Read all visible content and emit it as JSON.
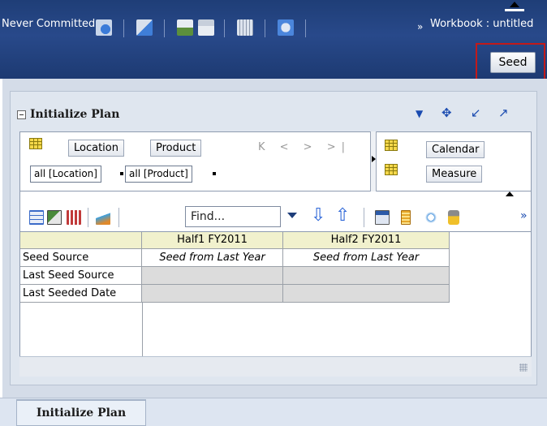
{
  "header": {
    "status_text": "Never Committed",
    "more_label": "»",
    "workbook_label": "Workbook : untitled",
    "seed_button": "Seed"
  },
  "panel": {
    "title": "Initialize Plan"
  },
  "dimensions": {
    "location_button": "Location",
    "product_button": "Product",
    "location_selection": "all [Location]",
    "product_selection": "all [Product]",
    "calendar_button": "Calendar",
    "measure_button": "Measure",
    "nav_arrows": "K < > >|"
  },
  "toolbar": {
    "find_value": "Find...",
    "more_label": "»"
  },
  "grid": {
    "columns": [
      "Half1 FY2011",
      "Half2 FY2011"
    ],
    "rows": [
      {
        "label": "Seed Source",
        "values": [
          "Seed from Last Year",
          "Seed from Last Year"
        ]
      },
      {
        "label": "Last Seed Source",
        "values": [
          "",
          ""
        ]
      },
      {
        "label": "Last Seeded Date",
        "values": [
          "",
          ""
        ]
      }
    ]
  },
  "tabs": [
    {
      "label": "Initialize Plan",
      "active": true
    }
  ],
  "colors": {
    "banner": "#1f3e77",
    "highlight_border": "#c21a1a",
    "column_header": "#f1f1cd",
    "readonly_cell": "#dcdcdc"
  }
}
